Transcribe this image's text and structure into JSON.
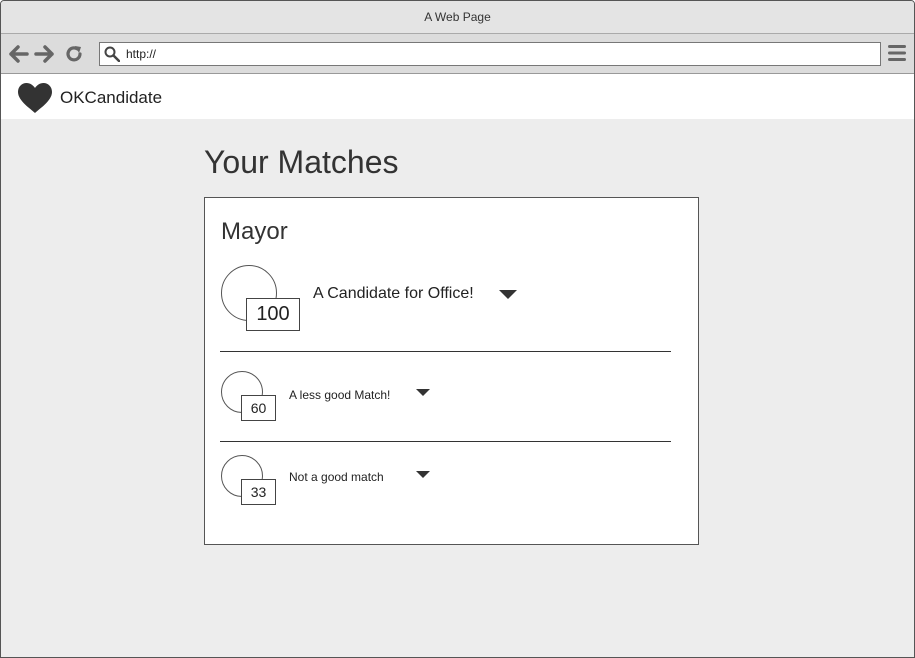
{
  "browser": {
    "window_title": "A Web Page",
    "url": "http://"
  },
  "app": {
    "brand": "OKCandidate",
    "logo_icon": "heart-icon"
  },
  "page": {
    "title": "Your Matches",
    "section": {
      "title": "Mayor",
      "matches": [
        {
          "score": "100",
          "name": "A Candidate for Office!"
        },
        {
          "score": "60",
          "name": "A less good Match!"
        },
        {
          "score": "33",
          "name": "Not a good match"
        }
      ]
    }
  },
  "colors": {
    "background": "#ededed",
    "text": "#333333",
    "border": "#555555"
  }
}
